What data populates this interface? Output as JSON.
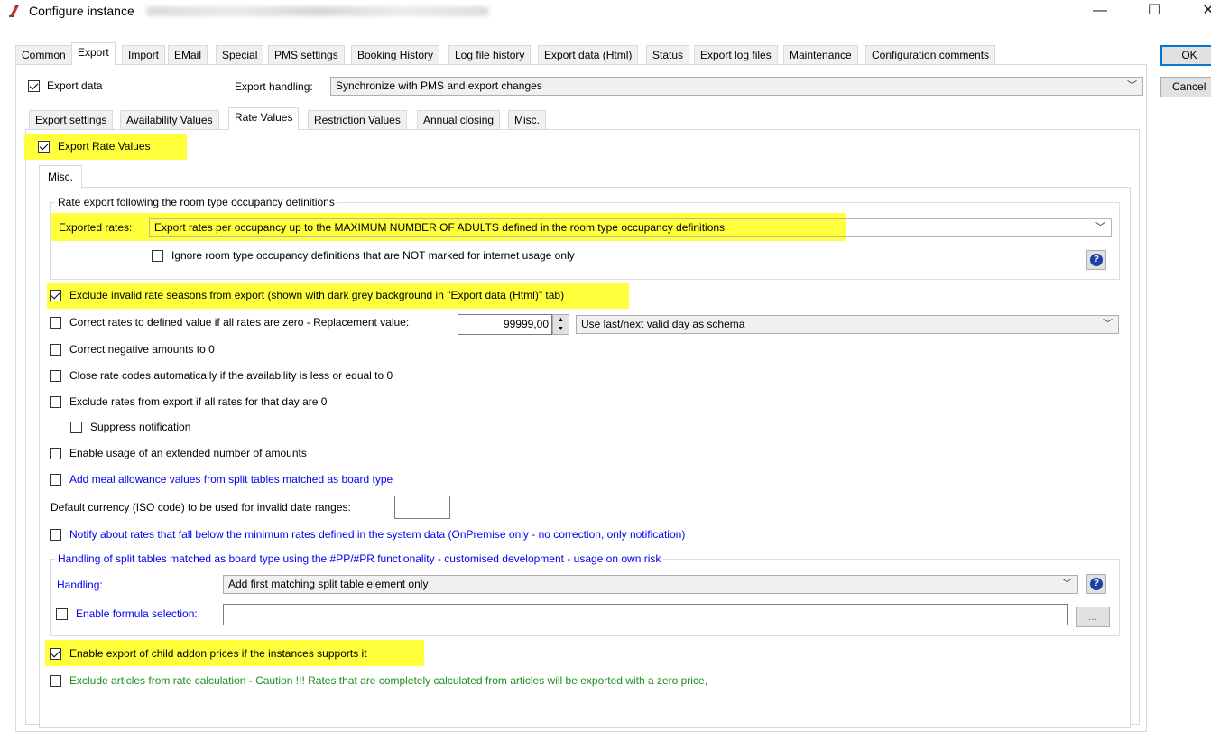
{
  "window": {
    "title": "Configure instance",
    "minimize": "—",
    "maximize": "☐",
    "close": "✕"
  },
  "dialog": {
    "ok_label": "OK",
    "cancel_label": "Cancel"
  },
  "main_tabs": [
    "Common",
    "Export",
    "Import",
    "EMail",
    "Special",
    "PMS settings",
    "Booking History",
    "Log file history",
    "Export data (Html)",
    "Status",
    "Export log files",
    "Maintenance",
    "Configuration comments"
  ],
  "main_active": "Export",
  "export": {
    "export_data_label": "Export data",
    "handling_label": "Export handling:",
    "handling_value": "Synchronize with PMS and export changes"
  },
  "sub_tabs": [
    "Export settings",
    "Availability Values",
    "Rate Values",
    "Restriction Values",
    "Annual closing",
    "Misc."
  ],
  "sub_active": "Rate Values",
  "rate": {
    "export_rate_values": "Export Rate Values",
    "misc_tab": "Misc.",
    "group1_title": "Rate export following the room type occupancy definitions",
    "exported_rates_label": "Exported rates:",
    "exported_rates_value": "Export rates per occupancy up to the MAXIMUM NUMBER OF ADULTS defined in the room type occupancy definitions",
    "ignore_label": "Ignore room type occupancy definitions that are NOT marked for internet usage only",
    "exclude_invalid": "Exclude invalid rate seasons from export (shown with dark grey background in \"Export data (Html)\" tab)",
    "correct_zero": "Correct rates to defined value if all rates are zero - Replacement value:",
    "replacement_value": "99999,00",
    "schema_value": "Use last/next valid day as schema",
    "correct_negative": "Correct negative amounts to 0",
    "close_codes": "Close rate codes automatically if the availability is less or equal to 0",
    "exclude_zero": "Exclude rates from export if all rates for that day are 0",
    "suppress": "Suppress notification",
    "extended": "Enable usage of an extended number of amounts",
    "meal": "Add meal allowance values from split tables matched as board type",
    "currency_label": "Default currency (ISO code) to be used for invalid date ranges:",
    "currency_value": "",
    "notify": "Notify about rates that fall below the minimum rates defined in the system data (OnPremise only - no correction, only notification)",
    "group2_title": "Handling of split tables matched as board type using the #PP/#PR functionality - customised development - usage on own risk",
    "handling_label": "Handling:",
    "handling_value": "Add first matching split table element only",
    "formula_label": "Enable formula selection:",
    "formula_value": "",
    "browse_label": "...",
    "child_addon": "Enable export of child addon prices if the instances supports it",
    "exclude_articles": "Exclude articles from rate calculation - Caution !!! Rates that are completely calculated from articles will be exported with a zero price,"
  },
  "colors": {
    "highlight": "#ffff3c",
    "blue_text": "#0000ee",
    "green_text": "#1a8f1a",
    "accent": "#0078d7"
  }
}
